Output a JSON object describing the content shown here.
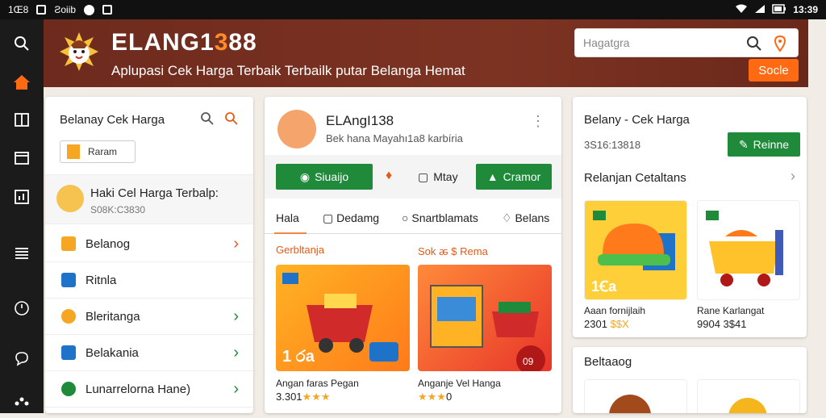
{
  "status_bar": {
    "left_text": "1Œ8",
    "app_label": "Ƨoiib",
    "time": "13:39"
  },
  "header": {
    "brand_prefix": "ELANG1",
    "brand_accent": "3",
    "brand_suffix": "88",
    "tagline": "Aplupasi Cek Harga Terbaik Terbailk putar Belanga Hemat",
    "search_placeholder": "Hagatgra",
    "search_button": "Socle"
  },
  "left_panel": {
    "title": "Belanay Cek Harga",
    "chip_label": "Raram",
    "profile_name": "Haki Cel Harga Terbalp:",
    "profile_sub": "S08K:C3830",
    "menu": [
      {
        "label": "Belanog",
        "icon": "shop-icon",
        "chev_color": "#e55a17",
        "icon_color": "#f5a623"
      },
      {
        "label": "Ritnla",
        "icon": "grid-icon",
        "chev_color": "",
        "icon_color": "#1e73c8"
      },
      {
        "label": "Bleritanga",
        "icon": "coin-icon",
        "chev_color": "#1f8a3a",
        "icon_color": "#f5a623"
      },
      {
        "label": "Belakania",
        "icon": "folder-icon",
        "chev_color": "#1f8a3a",
        "icon_color": "#1e73c8"
      },
      {
        "label": "Lunarrelorna Hane)",
        "icon": "leaf-icon",
        "chev_color": "#1f8a3a",
        "icon_color": "#1f8a3a"
      }
    ]
  },
  "center_panel": {
    "name": "ELAngI138",
    "subtitle": "Bek hana Mayahı1a8 karbíria",
    "btn_primary": "Siuaijo",
    "btn_ghost": "Mtay",
    "btn_secondary": "Cramor",
    "tabs": [
      "Hala",
      "Dedamg",
      "Snartblamats",
      "Belans"
    ],
    "sec_left": "Gerbltanja",
    "sec_right": "Sok ꬱ $ Rema",
    "card1": {
      "title": "Angan faras Pegan",
      "price": "3.301",
      "stars": "★★★",
      "badge": "1 රa"
    },
    "card2": {
      "title": "Anganje Vel Hanga",
      "price": "",
      "stars": "★★★",
      "suffix": "0",
      "badge": "09"
    }
  },
  "right_panel": {
    "title": "Belany - Cek Harga",
    "code": "3S16:13818",
    "button": "Reinne",
    "section": "Relanjan Cetaltans",
    "products": [
      {
        "name": "Aaan fornijlaih",
        "price": "2301",
        "price_suffix": "$$X",
        "badge": "1Ꞓa"
      },
      {
        "name": "Rane Karlangat",
        "price": "9904",
        "price_suffix": "3$41",
        "badge": ""
      }
    ]
  },
  "bottom_panel": {
    "title": "Beltaaog"
  },
  "colors": {
    "brand_orange": "#ff6a13",
    "header_brown": "#7d3322",
    "green": "#1f8a3a"
  }
}
